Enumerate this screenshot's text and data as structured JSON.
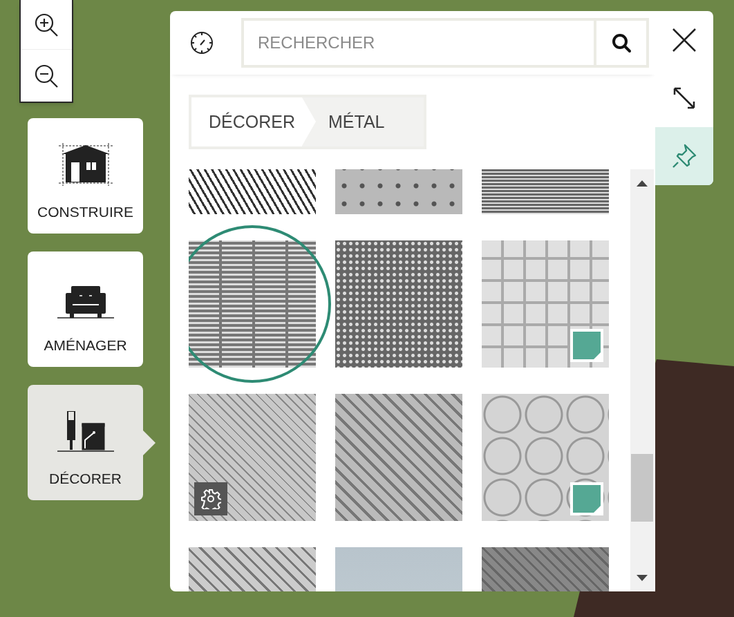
{
  "modes": [
    {
      "label": "CONSTRUIRE",
      "kind": "build",
      "selected": false
    },
    {
      "label": "AMÉNAGER",
      "kind": "furnish",
      "selected": false
    },
    {
      "label": "DÉCORER",
      "kind": "decorate",
      "selected": true
    }
  ],
  "search": {
    "placeholder": "RECHERCHER"
  },
  "breadcrumb": [
    "DÉCORER",
    "MÉTAL"
  ],
  "side_tools": {
    "pinned": true
  },
  "tiles": [
    {
      "selected": false,
      "material_badge": false,
      "settings_badge": false
    },
    {
      "selected": false,
      "material_badge": false,
      "settings_badge": false
    },
    {
      "selected": false,
      "material_badge": false,
      "settings_badge": false
    },
    {
      "selected": true,
      "material_badge": false,
      "settings_badge": false
    },
    {
      "selected": false,
      "material_badge": false,
      "settings_badge": false
    },
    {
      "selected": false,
      "material_badge": true,
      "settings_badge": false
    },
    {
      "selected": false,
      "material_badge": false,
      "settings_badge": true
    },
    {
      "selected": false,
      "material_badge": false,
      "settings_badge": false
    },
    {
      "selected": false,
      "material_badge": true,
      "settings_badge": false
    },
    {
      "selected": false,
      "material_badge": false,
      "settings_badge": false
    },
    {
      "selected": false,
      "material_badge": false,
      "settings_badge": false
    },
    {
      "selected": false,
      "material_badge": false,
      "settings_badge": false
    }
  ]
}
